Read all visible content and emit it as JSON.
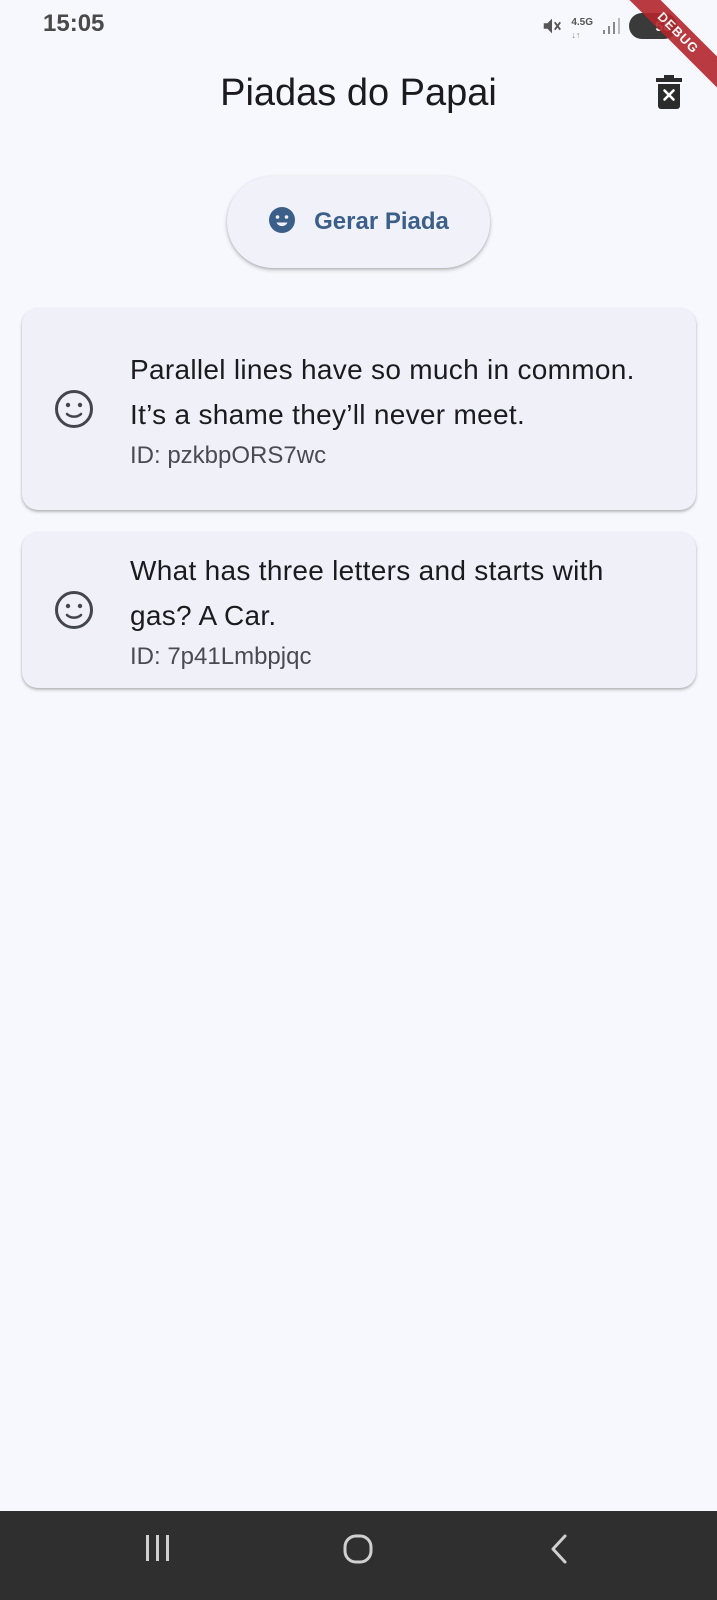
{
  "status_bar": {
    "time": "15:05",
    "network": "4.5G",
    "network_arrows": "↓↑",
    "battery": "50",
    "icons": [
      "mute-icon",
      "network-icon",
      "signal-icon",
      "battery-icon"
    ]
  },
  "debug_banner": "DEBUG",
  "app_bar": {
    "title": "Piadas do Papai",
    "action_icon": "delete-forever-icon"
  },
  "generate_button": {
    "label": "Gerar Piada",
    "icon": "smile-icon"
  },
  "jokes": [
    {
      "icon": "smile-outline-icon",
      "text": "Parallel lines have so much in common. It’s a shame they’ll never meet.",
      "id": "ID: pzkbpORS7wc"
    },
    {
      "icon": "smile-outline-icon",
      "text": "What has three letters and starts with gas? A Car.",
      "id": "ID: 7p41Lmbpjqc"
    }
  ],
  "nav_bar": {
    "buttons": [
      "recent-apps-icon",
      "home-icon",
      "back-icon"
    ]
  },
  "colors": {
    "background": "#f7f8fd",
    "card": "#f0f1f8",
    "accent": "#3c5f8a",
    "nav_bar": "#2f2f2f",
    "debug_banner": "#b3262c"
  }
}
